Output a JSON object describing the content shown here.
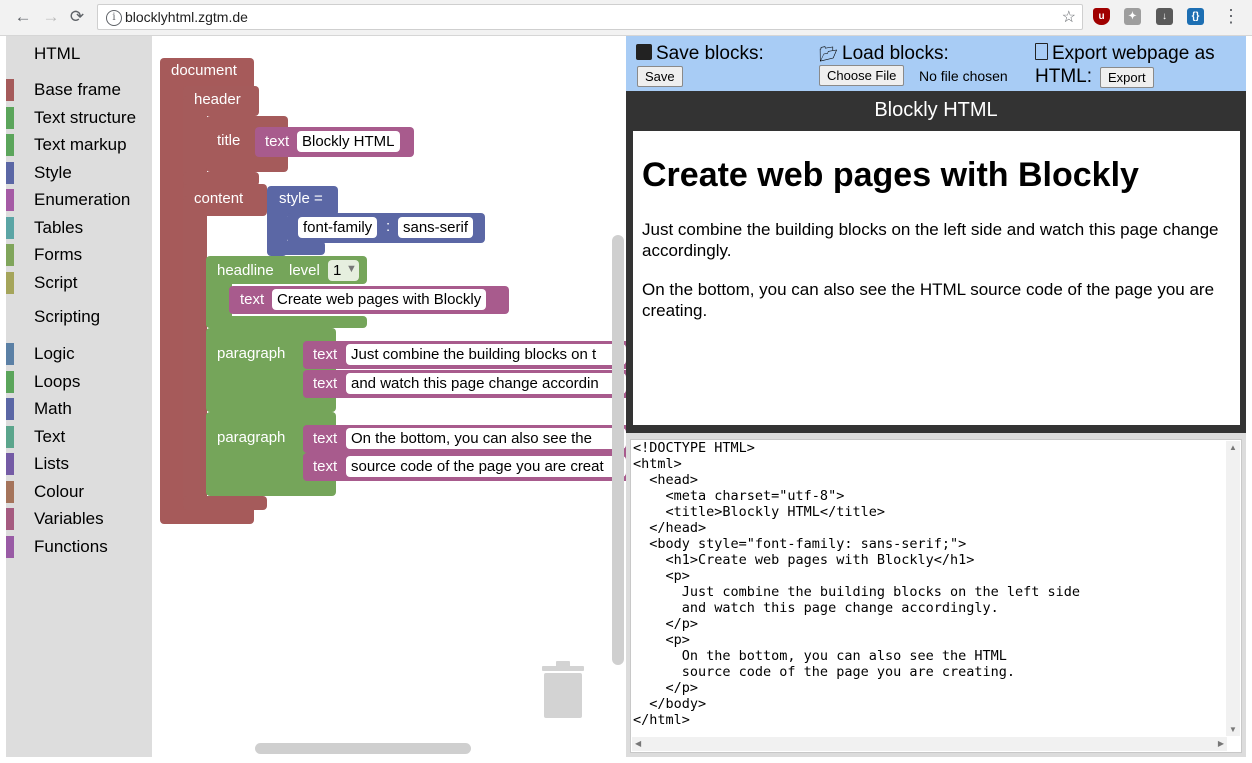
{
  "browser": {
    "url": "blocklyhtml.zgtm.de",
    "back_icon": "←",
    "forward_icon": "→",
    "reload_icon": "⟳",
    "star_icon": "☆",
    "menu_icon": "⋮"
  },
  "toolbox": {
    "section1": "HTML",
    "items1": [
      {
        "label": "Base frame",
        "color": "#a55b5b"
      },
      {
        "label": "Text structure",
        "color": "#5ba55b"
      },
      {
        "label": "Text markup",
        "color": "#5ba55b"
      },
      {
        "label": "Style",
        "color": "#5b67a5"
      },
      {
        "label": "Enumeration",
        "color": "#a55ba5"
      },
      {
        "label": "Tables",
        "color": "#5ba5a5"
      },
      {
        "label": "Forms",
        "color": "#80a55b"
      },
      {
        "label": "Script",
        "color": "#a5a55b"
      }
    ],
    "section2": "Scripting",
    "items2": [
      {
        "label": "Logic",
        "color": "#5b80a5"
      },
      {
        "label": "Loops",
        "color": "#5ba55b"
      },
      {
        "label": "Math",
        "color": "#5b67a5"
      },
      {
        "label": "Text",
        "color": "#5ba58c"
      },
      {
        "label": "Lists",
        "color": "#745ba5"
      },
      {
        "label": "Colour",
        "color": "#a5745b"
      },
      {
        "label": "Variables",
        "color": "#a55b80"
      },
      {
        "label": "Functions",
        "color": "#995ba5"
      }
    ]
  },
  "blocks": {
    "document": "document",
    "header": "header",
    "title": "title",
    "title_text_kw": "text",
    "title_text": "Blockly HTML",
    "content": "content",
    "style": "style =",
    "style_prop": "font-family",
    "style_colon": ":",
    "style_value": "sans-serif",
    "headline": "headline",
    "level": "level",
    "level_value": "1",
    "headline_text_kw": "text",
    "headline_text": "Create web pages with Blockly",
    "paragraph1": "paragraph",
    "p1_kw1": "text",
    "p1_text1": "Just combine the building blocks on t",
    "p1_kw2": "text",
    "p1_text2": "and watch this page change accordin",
    "paragraph2": "paragraph",
    "p2_kw1": "text",
    "p2_text1": "On the bottom, you can also see the",
    "p2_kw2": "text",
    "p2_text2": "source code of the page you are creat"
  },
  "topbar": {
    "save_title": "Save blocks:",
    "save_btn": "Save",
    "load_title": "Load blocks:",
    "choose_btn": "Choose File",
    "no_file": "No file chosen",
    "export_title_1": "Export webpage as",
    "export_title_2": "HTML:",
    "export_btn": "Export"
  },
  "preview": {
    "header": "Blockly HTML",
    "h1": "Create web pages with Blockly",
    "p1": "Just combine the building blocks on the left side and watch this page change accordingly.",
    "p2": "On the bottom, you can also see the HTML source code of the page you are creating."
  },
  "source_code": "<!DOCTYPE HTML>\n<html>\n  <head>\n    <meta charset=\"utf-8\">\n    <title>Blockly HTML</title>\n  </head>\n  <body style=\"font-family: sans-serif;\">\n    <h1>Create web pages with Blockly</h1>\n    <p>\n      Just combine the building blocks on the left side\n      and watch this page change accordingly.\n    </p>\n    <p>\n      On the bottom, you can also see the HTML\n      source code of the page you are creating.\n    </p>\n  </body>\n</html>"
}
